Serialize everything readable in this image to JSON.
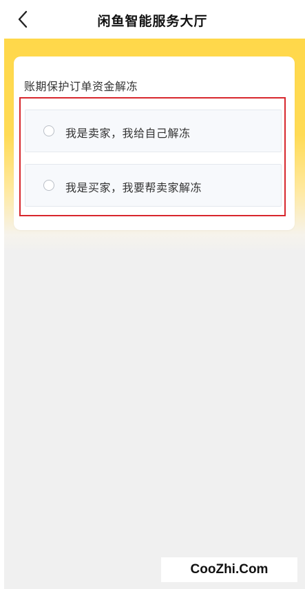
{
  "header": {
    "title": "闲鱼智能服务大厅",
    "back_icon": "chevron-left-icon"
  },
  "card": {
    "title": "账期保护订单资金解冻",
    "options": [
      {
        "label": "我是卖家，我给自己解冻",
        "selected": false
      },
      {
        "label": "我是买家，我要帮卖家解冻",
        "selected": false
      }
    ]
  },
  "colors": {
    "accent_yellow": "#ffd84a",
    "highlight_red": "#d7262c",
    "background": "#f0f0f0"
  },
  "watermark": {
    "text": "CooZhi.Com"
  }
}
